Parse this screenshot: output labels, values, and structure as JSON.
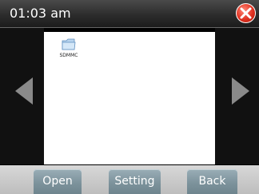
{
  "title_bar": {
    "time": "01:03 am",
    "close_icon": "close-icon"
  },
  "navigation": {
    "prev_icon": "arrow-left-icon",
    "next_icon": "arrow-right-icon"
  },
  "file_browser": {
    "items": [
      {
        "label": "SDMMC",
        "icon": "folder-icon"
      }
    ]
  },
  "toolbar": {
    "open_label": "Open",
    "setting_label": "Setting",
    "back_label": "Back"
  },
  "colors": {
    "close_button": "#e03020",
    "button_face": "#7d939c",
    "bottom_bar": "#c8c8c8"
  }
}
